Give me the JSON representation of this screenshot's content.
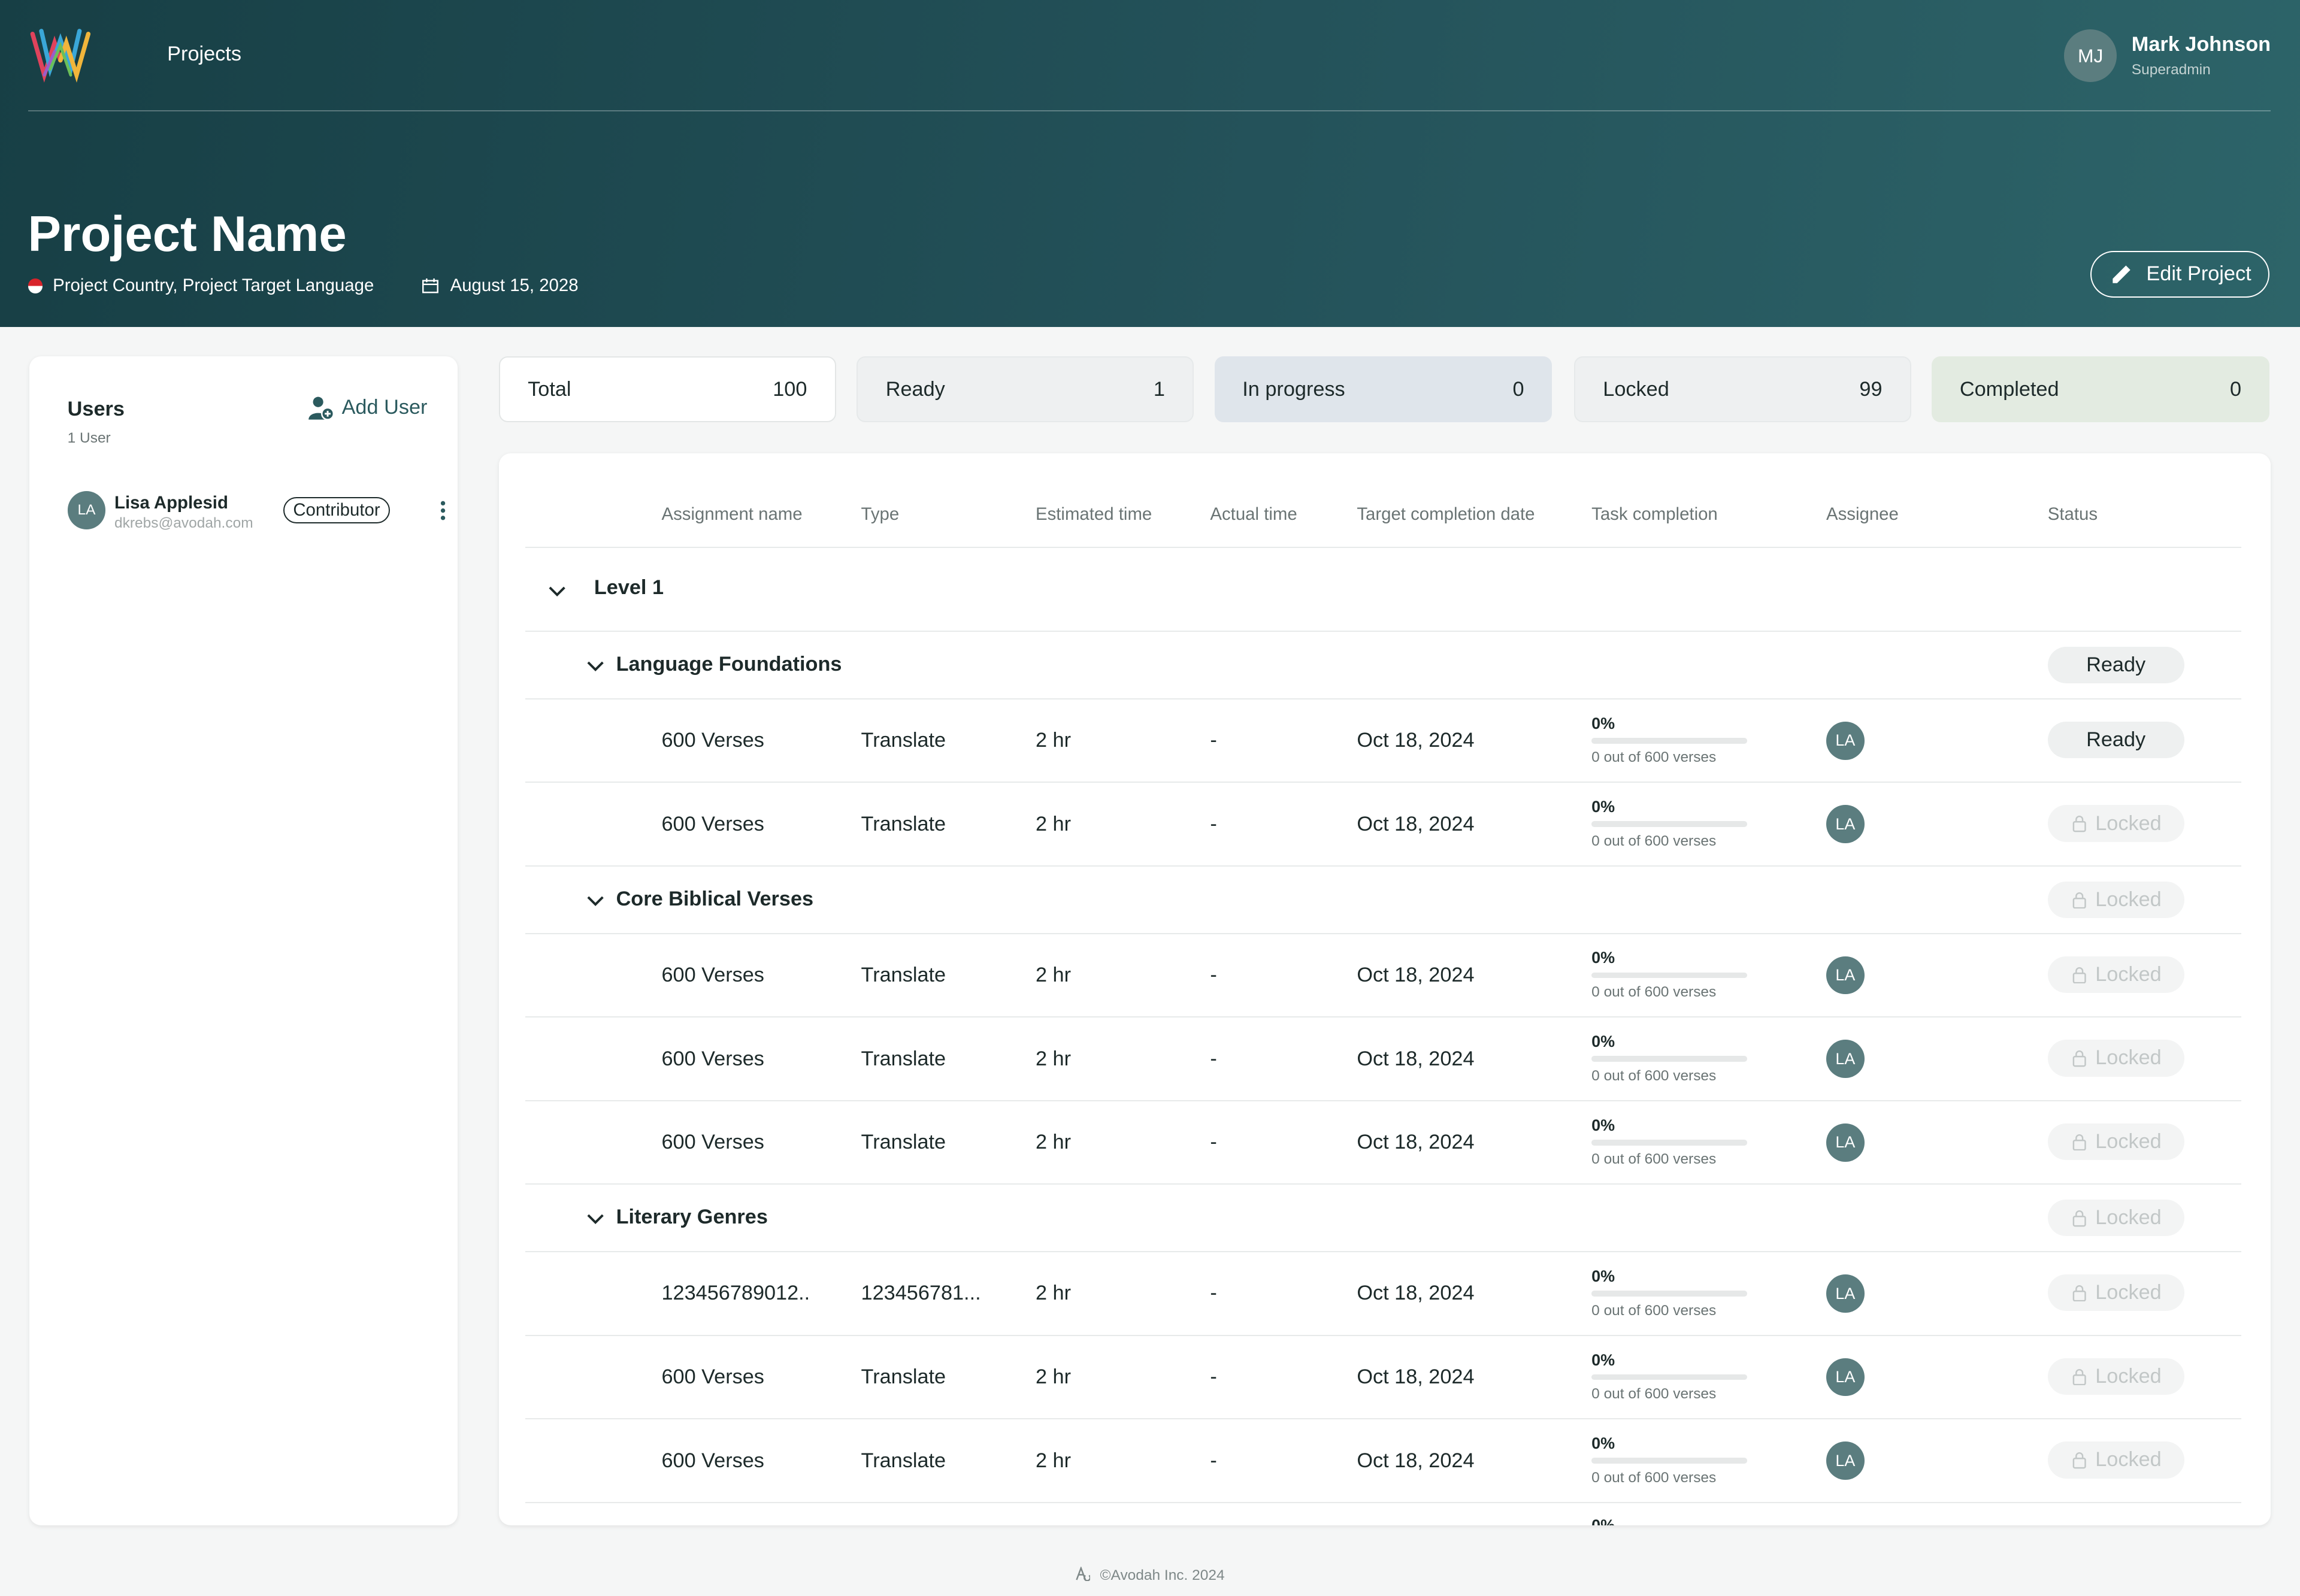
{
  "header": {
    "nav_projects": "Projects",
    "user": {
      "initials": "MJ",
      "name": "Mark Johnson",
      "role": "Superadmin"
    },
    "project_title": "Project Name",
    "project_location": "Project Country, Project Target Language",
    "project_date": "August 15, 2028",
    "edit_button": "Edit Project"
  },
  "users_panel": {
    "title": "Users",
    "count": "1 User",
    "add_user": "Add User",
    "members": [
      {
        "initials": "LA",
        "name": "Lisa Applesid",
        "email": "dkrebs@avodah.com",
        "role": "Contributor"
      }
    ]
  },
  "stats": [
    {
      "label": "Total",
      "value": "100"
    },
    {
      "label": "Ready",
      "value": "1"
    },
    {
      "label": "In progress",
      "value": "0"
    },
    {
      "label": "Locked",
      "value": "99"
    },
    {
      "label": "Completed",
      "value": "0"
    }
  ],
  "table": {
    "columns": [
      "Assignment name",
      "Type",
      "Estimated time",
      "Actual time",
      "Target completion date",
      "Task completion",
      "Assignee",
      "Status"
    ],
    "level": "Level 1",
    "groups": [
      {
        "name": "Language Foundations",
        "status": "Ready"
      },
      {
        "name": "Core Biblical Verses",
        "status": "Locked"
      },
      {
        "name": "Literary Genres",
        "status": "Locked"
      }
    ],
    "rows": [
      {
        "name": "600 Verses",
        "type": "Translate",
        "est": "2 hr",
        "actual": "-",
        "date": "Oct 18, 2024",
        "pct": "0%",
        "progress": 0,
        "sub": "0 out of 600 verses",
        "assignee": "LA",
        "status": "Ready"
      },
      {
        "name": "600 Verses",
        "type": "Translate",
        "est": "2 hr",
        "actual": "-",
        "date": "Oct 18, 2024",
        "pct": "0%",
        "progress": 0,
        "sub": "0 out of 600 verses",
        "assignee": "LA",
        "status": "Locked"
      },
      {
        "name": "600 Verses",
        "type": "Translate",
        "est": "2 hr",
        "actual": "-",
        "date": "Oct 18, 2024",
        "pct": "0%",
        "progress": 0,
        "sub": "0 out of 600 verses",
        "assignee": "LA",
        "status": "Locked"
      },
      {
        "name": "600 Verses",
        "type": "Translate",
        "est": "2 hr",
        "actual": "-",
        "date": "Oct 18, 2024",
        "pct": "0%",
        "progress": 0,
        "sub": "0 out of 600 verses",
        "assignee": "LA",
        "status": "Locked"
      },
      {
        "name": "600 Verses",
        "type": "Translate",
        "est": "2 hr",
        "actual": "-",
        "date": "Oct 18, 2024",
        "pct": "0%",
        "progress": 0,
        "sub": "0 out of 600 verses",
        "assignee": "LA",
        "status": "Locked"
      },
      {
        "name": "123456789012..",
        "type": "123456781...",
        "est": "2 hr",
        "actual": "-",
        "date": "Oct 18, 2024",
        "pct": "0%",
        "progress": 0,
        "sub": "0 out of 600 verses",
        "assignee": "LA",
        "status": "Locked"
      },
      {
        "name": "600 Verses",
        "type": "Translate",
        "est": "2 hr",
        "actual": "-",
        "date": "Oct 18, 2024",
        "pct": "0%",
        "progress": 0,
        "sub": "0 out of 600 verses",
        "assignee": "LA",
        "status": "Locked"
      },
      {
        "name": "600 Verses",
        "type": "Translate",
        "est": "2 hr",
        "actual": "-",
        "date": "Oct 18, 2024",
        "pct": "0%",
        "progress": 0,
        "sub": "0 out of 600 verses",
        "assignee": "LA",
        "status": "Locked"
      }
    ],
    "next_row_pct": "0%"
  },
  "footer": {
    "text": "©Avodah Inc. 2024"
  },
  "colors": {
    "header_dark": "#173f45",
    "accent": "#2b5a5e",
    "avatar": "#5b7d7f"
  }
}
